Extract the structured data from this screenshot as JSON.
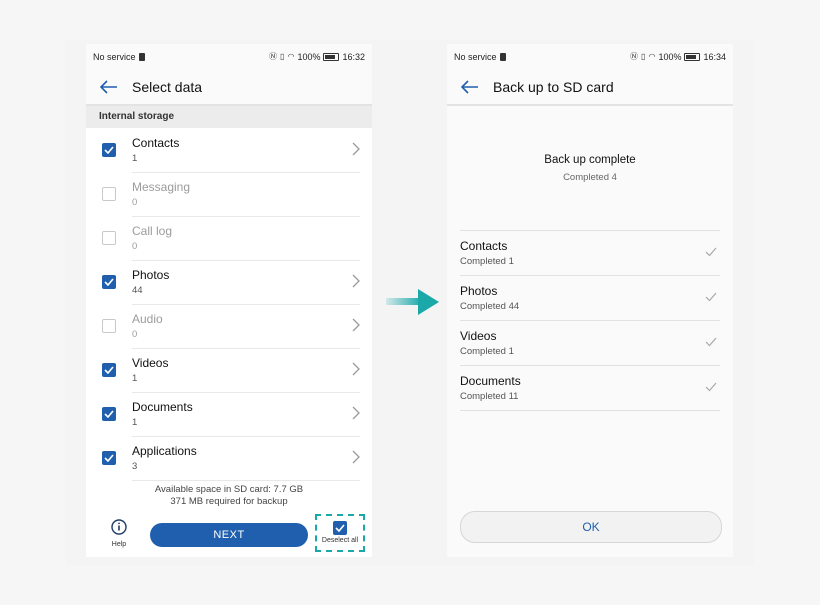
{
  "left_phone": {
    "status": {
      "carrier": "No service",
      "battery": "100%",
      "time": "16:32"
    },
    "title": "Select data",
    "section_header": "Internal storage",
    "items": [
      {
        "name": "Contacts",
        "count": "1",
        "checked": true,
        "enabled": true,
        "has_arrow": true
      },
      {
        "name": "Messaging",
        "count": "0",
        "checked": false,
        "enabled": false,
        "has_arrow": false
      },
      {
        "name": "Call log",
        "count": "0",
        "checked": false,
        "enabled": false,
        "has_arrow": false
      },
      {
        "name": "Photos",
        "count": "44",
        "checked": true,
        "enabled": true,
        "has_arrow": true
      },
      {
        "name": "Audio",
        "count": "0",
        "checked": false,
        "enabled": false,
        "has_arrow": true
      },
      {
        "name": "Videos",
        "count": "1",
        "checked": true,
        "enabled": true,
        "has_arrow": true
      },
      {
        "name": "Documents",
        "count": "1",
        "checked": true,
        "enabled": true,
        "has_arrow": true
      },
      {
        "name": "Applications",
        "count": "3",
        "checked": true,
        "enabled": true,
        "has_arrow": true
      }
    ],
    "space_line1": "Available space in SD card: 7.7 GB",
    "space_line2": "371 MB required for backup",
    "help_label": "Help",
    "next_label": "NEXT",
    "deselect_label": "Deselect all"
  },
  "right_phone": {
    "status": {
      "carrier": "No service",
      "battery": "100%",
      "time": "16:34"
    },
    "title": "Back up to SD card",
    "complete_title": "Back up complete",
    "complete_sub": "Completed 4",
    "results": [
      {
        "name": "Contacts",
        "status": "Completed 1"
      },
      {
        "name": "Photos",
        "status": "Completed 44"
      },
      {
        "name": "Videos",
        "status": "Completed 1"
      },
      {
        "name": "Documents",
        "status": "Completed 11"
      }
    ],
    "ok_label": "OK"
  },
  "colors": {
    "accent": "#1f5fae",
    "arrow": "#1aa8a8",
    "highlight": "#1aa8a8"
  }
}
